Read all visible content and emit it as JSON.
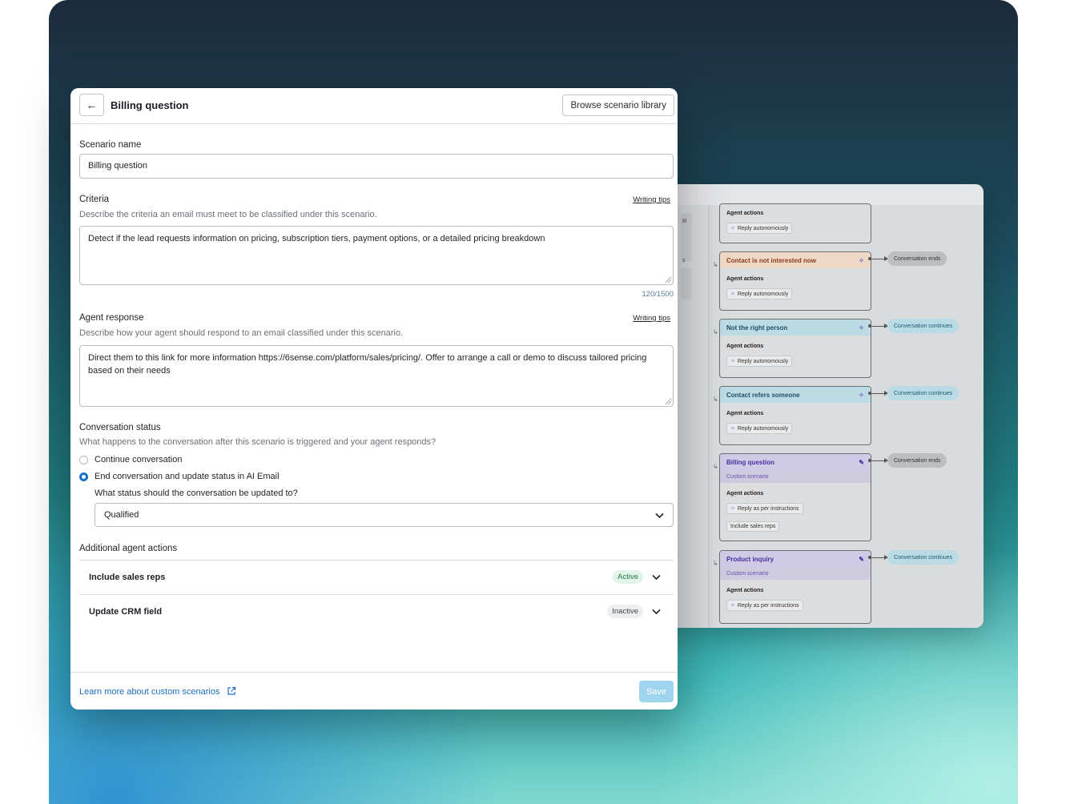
{
  "header": {
    "back_icon": "arrow-left-icon",
    "title": "Billing question",
    "browse_label": "Browse scenario library"
  },
  "scenario_name": {
    "label": "Scenario name",
    "value": "Billing question"
  },
  "criteria": {
    "label": "Criteria",
    "tips": "Writing tips",
    "description": "Describe the criteria an email must meet to be classified under this scenario.",
    "value": "Detect if the lead requests information on pricing, subscription tiers, payment options, or a detailed pricing breakdown",
    "counter": "120/1500"
  },
  "agent_response": {
    "label": "Agent response",
    "tips": "Writing tips",
    "description": "Describe how your agent should respond to an email classified under this scenario.",
    "value": "Direct them to this link for more information https://6sense.com/platform/sales/pricing/. Offer to arrange a call or demo to discuss tailored pricing based on their needs"
  },
  "conversation_status": {
    "label": "Conversation status",
    "description": "What happens to the conversation after this scenario is triggered and your agent responds?",
    "options": [
      {
        "label": "Continue conversation",
        "selected": false
      },
      {
        "label": "End conversation and update status in AI Email",
        "selected": true
      }
    ],
    "status_question": "What status should the conversation be updated to?",
    "status_value": "Qualified"
  },
  "additional_actions": {
    "label": "Additional agent actions",
    "items": [
      {
        "title": "Include sales reps",
        "badge": "Active"
      },
      {
        "title": "Update CRM field",
        "badge": "Inactive"
      }
    ]
  },
  "footer": {
    "learn_link": "Learn more about custom scenarios",
    "save_label": "Save"
  },
  "flow": {
    "left_fragments": [
      "til",
      "s"
    ],
    "nodes": [
      {
        "title": "",
        "agent_actions": "Agent actions",
        "chips": [
          "Reply autonomously"
        ]
      },
      {
        "title": "Contact is not interested now",
        "agent_actions": "Agent actions",
        "chips": [
          "Reply autonomously"
        ],
        "outcome": "Conversation ends"
      },
      {
        "title": "Not the right person",
        "agent_actions": "Agent actions",
        "chips": [
          "Reply autonomously"
        ],
        "outcome": "Conversation continues"
      },
      {
        "title": "Contact refers someone",
        "agent_actions": "Agent actions",
        "chips": [
          "Reply autonomously"
        ],
        "outcome": "Conversation continues"
      },
      {
        "title": "Billing question",
        "subtitle": "Custom scenario",
        "agent_actions": "Agent actions",
        "chips": [
          "Reply as per instructions",
          "Include sales reps"
        ],
        "outcome": "Conversation ends"
      },
      {
        "title": "Product inquiry",
        "subtitle": "Custom scenario",
        "agent_actions": "Agent actions",
        "chips": [
          "Reply as per instructions"
        ],
        "outcome": "Conversation continues"
      }
    ],
    "colors": {
      "not_interested": "#efd8c6",
      "info_blue": "#bcdbe5",
      "custom_purple": "#cfcbe6"
    }
  },
  "colors": {
    "accent": "#1a6fc9",
    "save_disabled": "#9fd4ee"
  }
}
